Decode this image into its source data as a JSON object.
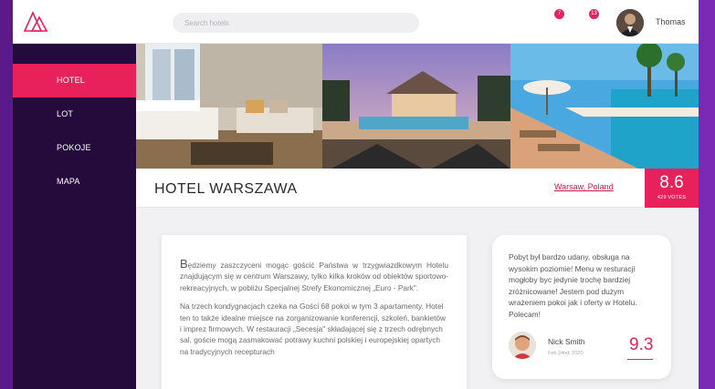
{
  "search": {
    "placeholder": "Search hotels"
  },
  "notifications": {
    "messages_count": "7",
    "alerts_count": "13"
  },
  "user": {
    "name": "Thomas"
  },
  "sidebar": {
    "items": [
      {
        "label": "HOTEL",
        "active": true
      },
      {
        "label": "LOT",
        "active": false
      },
      {
        "label": "POKOJE",
        "active": false
      },
      {
        "label": "MAPA",
        "active": false
      }
    ]
  },
  "hotel": {
    "title": "HOTEL WARSZAWA",
    "location": "Warsaw, Poland",
    "rating": "8.6",
    "votes": "429 VOTES"
  },
  "description": {
    "first_letter": "B",
    "paragraph1": "ędziemy zaszczyceni mogąc gościć Państwa w trzygwiazdkowym Hotelu znajdującym się w centrum Warszawy, tylko kilka kroków od obiektów sportowo-rekreacyjnych, w pobliżu Specjalnej Strefy Ekonomicznej „Euro - Park\".",
    "paragraph2": "Na trzech kondygnacjach czeka na Gości 68 pokoi w tym 3 apartamenty. Hotel ten to także idealne miejsce na zorganizowanie konferencji, szkoleń, bankietów i imprez firmowych. W restauracji „Secesja\" składającej się z trzech odrębnych sal, goście mogą zasmakować potrawy kuchni polskiej i europejskiej opartych na tradycyjnych recepturach"
  },
  "review": {
    "text": "Pobyt był bardzo udany, obsługa na wysokim poziomie! Menu w resturacji mogłoby byc jedynie trochę bardziej zróżnicowane! Jestem pod dużym wrażeniem pokoi jak i oferty w Hotelu. Polecam!",
    "author": "Nick Smith",
    "date": "Feb 24nd, 2020",
    "score": "9.3"
  },
  "colors": {
    "accent": "#e8215a",
    "sidebar": "#240b3c",
    "background_purple": "#6a1fa0"
  }
}
